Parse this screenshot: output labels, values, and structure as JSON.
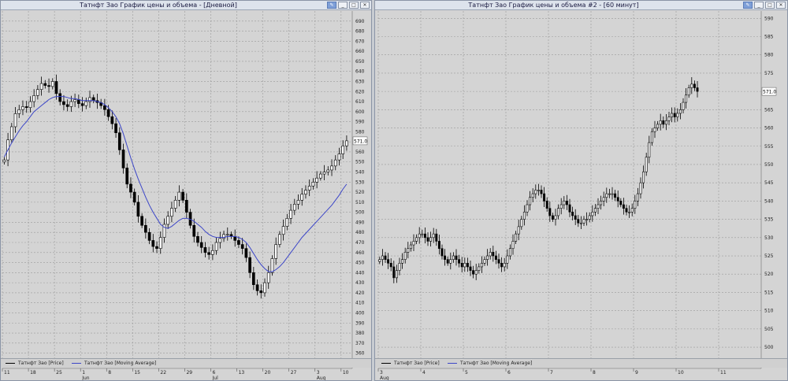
{
  "windows": [
    {
      "title": "Татнфт Зао График цены и объема - [Дневной]",
      "legend": [
        "Татнфт Зао [Price]",
        "Татнфт Зао [Moving Average]"
      ],
      "last_price_label": "571.0"
    },
    {
      "title": "Татнфт Зао График цены и объема #2 - [60 минут]",
      "legend": [
        "Татнфт Зао [Price]",
        "Татнфт Зао [Moving Average]"
      ],
      "last_price_label": "571.0"
    }
  ],
  "window_buttons": [
    "edit-pen",
    "minimize",
    "maximize",
    "close"
  ],
  "colors": {
    "background": "#d4d4d4",
    "grid": "#9a9a9a",
    "candle": "#000000",
    "ma": "#3c46c8"
  },
  "chart_data": [
    {
      "type": "line",
      "subtype": "candlestick",
      "timeframe": "Дневной",
      "ylim": [
        355,
        700
      ],
      "yticks": [
        360,
        370,
        380,
        390,
        400,
        410,
        420,
        430,
        440,
        450,
        460,
        470,
        480,
        490,
        500,
        510,
        520,
        530,
        540,
        550,
        560,
        570,
        580,
        590,
        600,
        610,
        620,
        630,
        640,
        650,
        660,
        670,
        680,
        690
      ],
      "xticks": [
        {
          "day": "11",
          "month": "",
          "i": 0
        },
        {
          "day": "18",
          "month": "",
          "i": 7
        },
        {
          "day": "25",
          "month": "",
          "i": 14
        },
        {
          "day": "1",
          "month": "Jun",
          "i": 21
        },
        {
          "day": "8",
          "month": "",
          "i": 28
        },
        {
          "day": "15",
          "month": "",
          "i": 35
        },
        {
          "day": "22",
          "month": "",
          "i": 42
        },
        {
          "day": "29",
          "month": "",
          "i": 49
        },
        {
          "day": "6",
          "month": "Jul",
          "i": 56
        },
        {
          "day": "13",
          "month": "",
          "i": 63
        },
        {
          "day": "20",
          "month": "",
          "i": 70
        },
        {
          "day": "27",
          "month": "",
          "i": 77
        },
        {
          "day": "3",
          "month": "Aug",
          "i": 84
        },
        {
          "day": "10",
          "month": "",
          "i": 91
        }
      ],
      "n_slots": 94,
      "close": [
        552,
        572,
        585,
        598,
        602,
        605,
        604,
        610,
        616,
        622,
        628,
        626,
        625,
        630,
        618,
        610,
        607,
        605,
        610,
        612,
        608,
        606,
        610,
        614,
        611,
        609,
        606,
        602,
        595,
        588,
        579,
        562,
        544,
        528,
        520,
        510,
        496,
        487,
        480,
        472,
        466,
        464,
        475,
        488,
        496,
        504,
        512,
        520,
        512,
        500,
        487,
        476,
        470,
        465,
        460,
        458,
        462,
        470,
        474,
        478,
        478,
        476,
        472,
        468,
        464,
        455,
        440,
        428,
        422,
        420,
        430,
        440,
        454,
        468,
        478,
        486,
        494,
        502,
        508,
        512,
        518,
        522,
        526,
        530,
        534,
        538,
        540,
        542,
        546,
        552,
        558,
        566,
        571
      ],
      "ma": [
        555,
        562,
        569,
        575,
        581,
        586,
        590,
        595,
        600,
        603,
        606,
        609,
        612,
        614,
        615,
        615,
        615,
        614,
        613,
        613,
        612,
        611,
        611,
        611,
        611,
        610,
        609,
        607,
        604,
        600,
        595,
        588,
        578,
        566,
        554,
        543,
        533,
        524,
        515,
        507,
        500,
        494,
        488,
        485,
        484,
        486,
        489,
        492,
        494,
        494,
        493,
        491,
        488,
        485,
        481,
        478,
        476,
        475,
        475,
        475,
        476,
        476,
        476,
        475,
        473,
        470,
        465,
        459,
        453,
        448,
        444,
        441,
        441,
        443,
        446,
        450,
        455,
        460,
        465,
        470,
        475,
        479,
        483,
        487,
        491,
        495,
        499,
        503,
        507,
        512,
        517,
        523,
        528
      ]
    },
    {
      "type": "line",
      "subtype": "candlestick",
      "timeframe": "60 минут",
      "ylim": [
        497,
        592
      ],
      "yticks": [
        500,
        505,
        510,
        515,
        520,
        525,
        530,
        535,
        540,
        545,
        550,
        555,
        560,
        565,
        570,
        575,
        580,
        585,
        590
      ],
      "xticks": [
        {
          "day": "3",
          "month": "Aug",
          "i": 0
        },
        {
          "day": "4",
          "month": "",
          "i": 15
        },
        {
          "day": "5",
          "month": "",
          "i": 30
        },
        {
          "day": "6",
          "month": "",
          "i": 45
        },
        {
          "day": "7",
          "month": "",
          "i": 60
        },
        {
          "day": "8",
          "month": "",
          "i": 75
        },
        {
          "day": "9",
          "month": "",
          "i": 90
        },
        {
          "day": "10",
          "month": "",
          "i": 105
        },
        {
          "day": "11",
          "month": "",
          "i": 120
        }
      ],
      "n_slots": 135,
      "close": [
        524,
        525,
        524,
        523,
        522,
        519,
        521,
        523,
        524,
        526,
        527,
        528,
        529,
        530,
        531,
        531,
        530,
        529,
        530,
        531,
        529,
        527,
        525,
        524,
        523,
        524,
        525,
        524,
        523,
        522,
        523,
        522,
        521,
        520,
        521,
        522,
        523,
        524,
        525,
        526,
        525,
        524,
        523,
        522,
        523,
        525,
        527,
        529,
        531,
        533,
        535,
        537,
        539,
        541,
        542,
        543,
        543,
        542,
        540,
        538,
        536,
        535,
        536,
        538,
        539,
        540,
        539,
        537,
        536,
        535,
        534,
        534,
        535,
        535,
        536,
        537,
        538,
        539,
        540,
        541,
        542,
        542,
        542,
        541,
        540,
        539,
        538,
        537,
        537,
        538,
        540,
        542,
        545,
        548,
        552,
        556,
        559,
        560,
        561,
        562,
        561,
        562,
        563,
        564,
        563,
        564,
        565,
        567,
        569,
        571,
        572,
        571,
        570
      ]
    }
  ]
}
